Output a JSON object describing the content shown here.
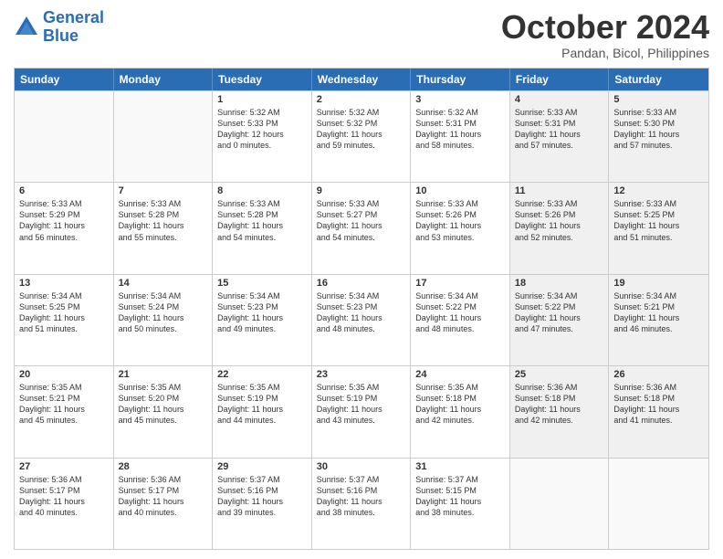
{
  "header": {
    "logo_general": "General",
    "logo_blue": "Blue",
    "month": "October 2024",
    "location": "Pandan, Bicol, Philippines"
  },
  "days_of_week": [
    "Sunday",
    "Monday",
    "Tuesday",
    "Wednesday",
    "Thursday",
    "Friday",
    "Saturday"
  ],
  "weeks": [
    [
      {
        "day": "",
        "lines": [],
        "empty": true
      },
      {
        "day": "",
        "lines": [],
        "empty": true
      },
      {
        "day": "1",
        "lines": [
          "Sunrise: 5:32 AM",
          "Sunset: 5:33 PM",
          "Daylight: 12 hours",
          "and 0 minutes."
        ]
      },
      {
        "day": "2",
        "lines": [
          "Sunrise: 5:32 AM",
          "Sunset: 5:32 PM",
          "Daylight: 11 hours",
          "and 59 minutes."
        ]
      },
      {
        "day": "3",
        "lines": [
          "Sunrise: 5:32 AM",
          "Sunset: 5:31 PM",
          "Daylight: 11 hours",
          "and 58 minutes."
        ]
      },
      {
        "day": "4",
        "lines": [
          "Sunrise: 5:33 AM",
          "Sunset: 5:31 PM",
          "Daylight: 11 hours",
          "and 57 minutes."
        ]
      },
      {
        "day": "5",
        "lines": [
          "Sunrise: 5:33 AM",
          "Sunset: 5:30 PM",
          "Daylight: 11 hours",
          "and 57 minutes."
        ]
      }
    ],
    [
      {
        "day": "6",
        "lines": [
          "Sunrise: 5:33 AM",
          "Sunset: 5:29 PM",
          "Daylight: 11 hours",
          "and 56 minutes."
        ]
      },
      {
        "day": "7",
        "lines": [
          "Sunrise: 5:33 AM",
          "Sunset: 5:28 PM",
          "Daylight: 11 hours",
          "and 55 minutes."
        ]
      },
      {
        "day": "8",
        "lines": [
          "Sunrise: 5:33 AM",
          "Sunset: 5:28 PM",
          "Daylight: 11 hours",
          "and 54 minutes."
        ]
      },
      {
        "day": "9",
        "lines": [
          "Sunrise: 5:33 AM",
          "Sunset: 5:27 PM",
          "Daylight: 11 hours",
          "and 54 minutes."
        ]
      },
      {
        "day": "10",
        "lines": [
          "Sunrise: 5:33 AM",
          "Sunset: 5:26 PM",
          "Daylight: 11 hours",
          "and 53 minutes."
        ]
      },
      {
        "day": "11",
        "lines": [
          "Sunrise: 5:33 AM",
          "Sunset: 5:26 PM",
          "Daylight: 11 hours",
          "and 52 minutes."
        ]
      },
      {
        "day": "12",
        "lines": [
          "Sunrise: 5:33 AM",
          "Sunset: 5:25 PM",
          "Daylight: 11 hours",
          "and 51 minutes."
        ]
      }
    ],
    [
      {
        "day": "13",
        "lines": [
          "Sunrise: 5:34 AM",
          "Sunset: 5:25 PM",
          "Daylight: 11 hours",
          "and 51 minutes."
        ]
      },
      {
        "day": "14",
        "lines": [
          "Sunrise: 5:34 AM",
          "Sunset: 5:24 PM",
          "Daylight: 11 hours",
          "and 50 minutes."
        ]
      },
      {
        "day": "15",
        "lines": [
          "Sunrise: 5:34 AM",
          "Sunset: 5:23 PM",
          "Daylight: 11 hours",
          "and 49 minutes."
        ]
      },
      {
        "day": "16",
        "lines": [
          "Sunrise: 5:34 AM",
          "Sunset: 5:23 PM",
          "Daylight: 11 hours",
          "and 48 minutes."
        ]
      },
      {
        "day": "17",
        "lines": [
          "Sunrise: 5:34 AM",
          "Sunset: 5:22 PM",
          "Daylight: 11 hours",
          "and 48 minutes."
        ]
      },
      {
        "day": "18",
        "lines": [
          "Sunrise: 5:34 AM",
          "Sunset: 5:22 PM",
          "Daylight: 11 hours",
          "and 47 minutes."
        ]
      },
      {
        "day": "19",
        "lines": [
          "Sunrise: 5:34 AM",
          "Sunset: 5:21 PM",
          "Daylight: 11 hours",
          "and 46 minutes."
        ]
      }
    ],
    [
      {
        "day": "20",
        "lines": [
          "Sunrise: 5:35 AM",
          "Sunset: 5:21 PM",
          "Daylight: 11 hours",
          "and 45 minutes."
        ]
      },
      {
        "day": "21",
        "lines": [
          "Sunrise: 5:35 AM",
          "Sunset: 5:20 PM",
          "Daylight: 11 hours",
          "and 45 minutes."
        ]
      },
      {
        "day": "22",
        "lines": [
          "Sunrise: 5:35 AM",
          "Sunset: 5:19 PM",
          "Daylight: 11 hours",
          "and 44 minutes."
        ]
      },
      {
        "day": "23",
        "lines": [
          "Sunrise: 5:35 AM",
          "Sunset: 5:19 PM",
          "Daylight: 11 hours",
          "and 43 minutes."
        ]
      },
      {
        "day": "24",
        "lines": [
          "Sunrise: 5:35 AM",
          "Sunset: 5:18 PM",
          "Daylight: 11 hours",
          "and 42 minutes."
        ]
      },
      {
        "day": "25",
        "lines": [
          "Sunrise: 5:36 AM",
          "Sunset: 5:18 PM",
          "Daylight: 11 hours",
          "and 42 minutes."
        ]
      },
      {
        "day": "26",
        "lines": [
          "Sunrise: 5:36 AM",
          "Sunset: 5:18 PM",
          "Daylight: 11 hours",
          "and 41 minutes."
        ]
      }
    ],
    [
      {
        "day": "27",
        "lines": [
          "Sunrise: 5:36 AM",
          "Sunset: 5:17 PM",
          "Daylight: 11 hours",
          "and 40 minutes."
        ]
      },
      {
        "day": "28",
        "lines": [
          "Sunrise: 5:36 AM",
          "Sunset: 5:17 PM",
          "Daylight: 11 hours",
          "and 40 minutes."
        ]
      },
      {
        "day": "29",
        "lines": [
          "Sunrise: 5:37 AM",
          "Sunset: 5:16 PM",
          "Daylight: 11 hours",
          "and 39 minutes."
        ]
      },
      {
        "day": "30",
        "lines": [
          "Sunrise: 5:37 AM",
          "Sunset: 5:16 PM",
          "Daylight: 11 hours",
          "and 38 minutes."
        ]
      },
      {
        "day": "31",
        "lines": [
          "Sunrise: 5:37 AM",
          "Sunset: 5:15 PM",
          "Daylight: 11 hours",
          "and 38 minutes."
        ]
      },
      {
        "day": "",
        "lines": [],
        "empty": true
      },
      {
        "day": "",
        "lines": [],
        "empty": true
      }
    ]
  ]
}
